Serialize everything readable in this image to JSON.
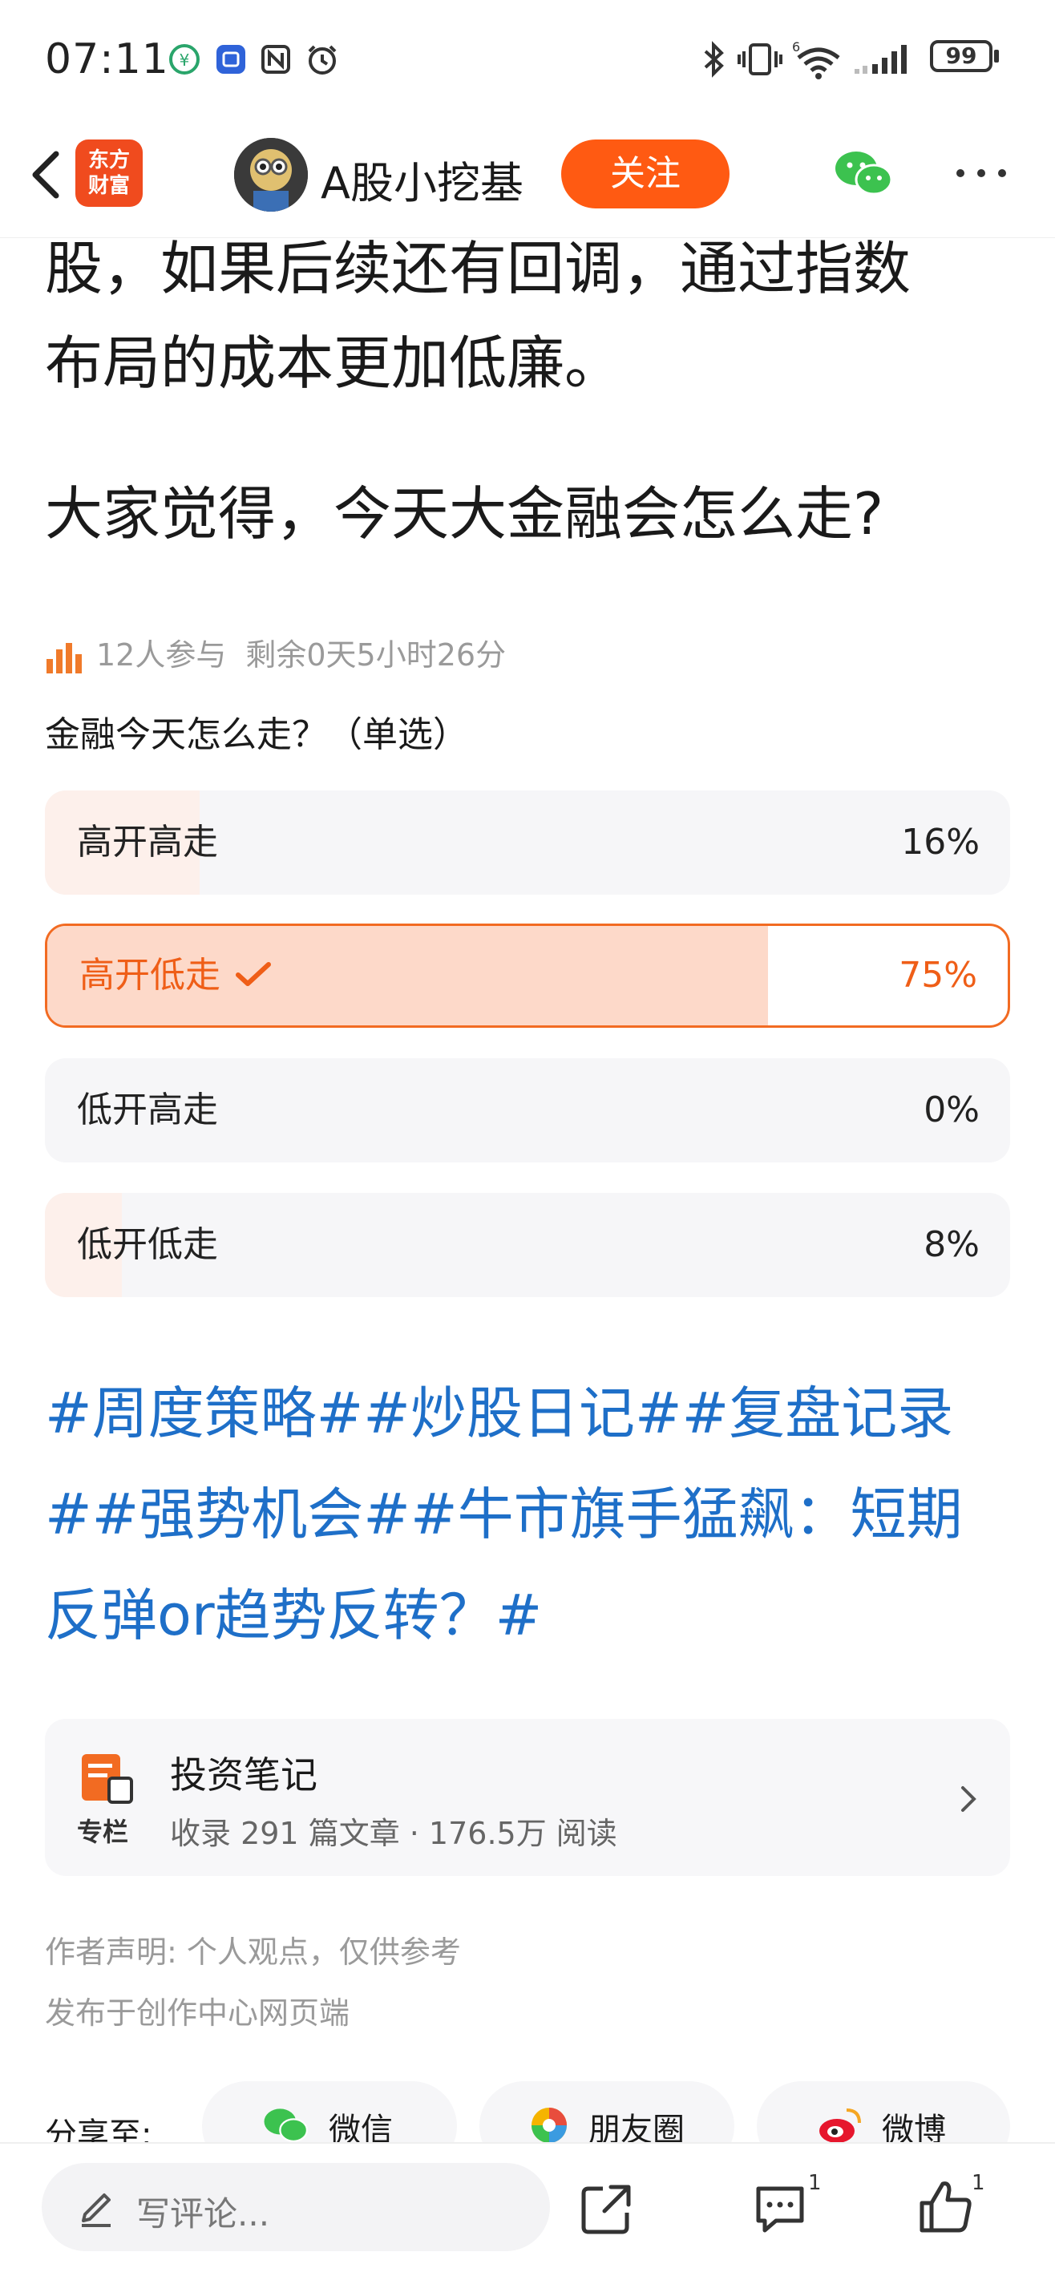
{
  "status_bar": {
    "time": "07:11",
    "battery": "99"
  },
  "header": {
    "app_logo_line1": "东方",
    "app_logo_line2": "财富",
    "author_name": "A股小挖基",
    "follow_label": "关注"
  },
  "article": {
    "line1": "股，如果后续还有回调，通过指数",
    "line2": "布局的成本更加低廉。",
    "question_line": "大家觉得，今天大金融会怎么走?"
  },
  "poll": {
    "participants": "12人参与",
    "remaining": "剩余0天5小时26分",
    "question": "金融今天怎么走？（单选）",
    "options": [
      {
        "label": "高开高走",
        "percent_text": "16%",
        "percent": 16,
        "selected": false
      },
      {
        "label": "高开低走",
        "percent_text": "75%",
        "percent": 75,
        "selected": true
      },
      {
        "label": "低开高走",
        "percent_text": "0%",
        "percent": 0,
        "selected": false
      },
      {
        "label": "低开低走",
        "percent_text": "8%",
        "percent": 8,
        "selected": false
      }
    ]
  },
  "hashtags": {
    "line1": "#周度策略##炒股日记##复盘记录",
    "line2": "##强势机会##牛市旗手猛飙：短期",
    "line3": "反弹or趋势反转？#"
  },
  "column": {
    "icon_label": "专栏",
    "title": "投资笔记",
    "subtitle": "收录 291 篇文章 · 176.5万 阅读"
  },
  "disclaimer": {
    "statement": "作者声明: 个人观点，仅供参考",
    "published": "发布于创作中心网页端"
  },
  "share": {
    "label": "分享至:",
    "wechat": "微信",
    "moments": "朋友圈",
    "weibo": "微博"
  },
  "bottom_bar": {
    "comment_placeholder": "写评论...",
    "comment_count": "1",
    "like_count": "1"
  },
  "colors": {
    "accent": "#ff5a12",
    "selected_border": "#f26b22",
    "hashtag": "#1e6fc8",
    "poll_fill": "#fdf0eb"
  }
}
